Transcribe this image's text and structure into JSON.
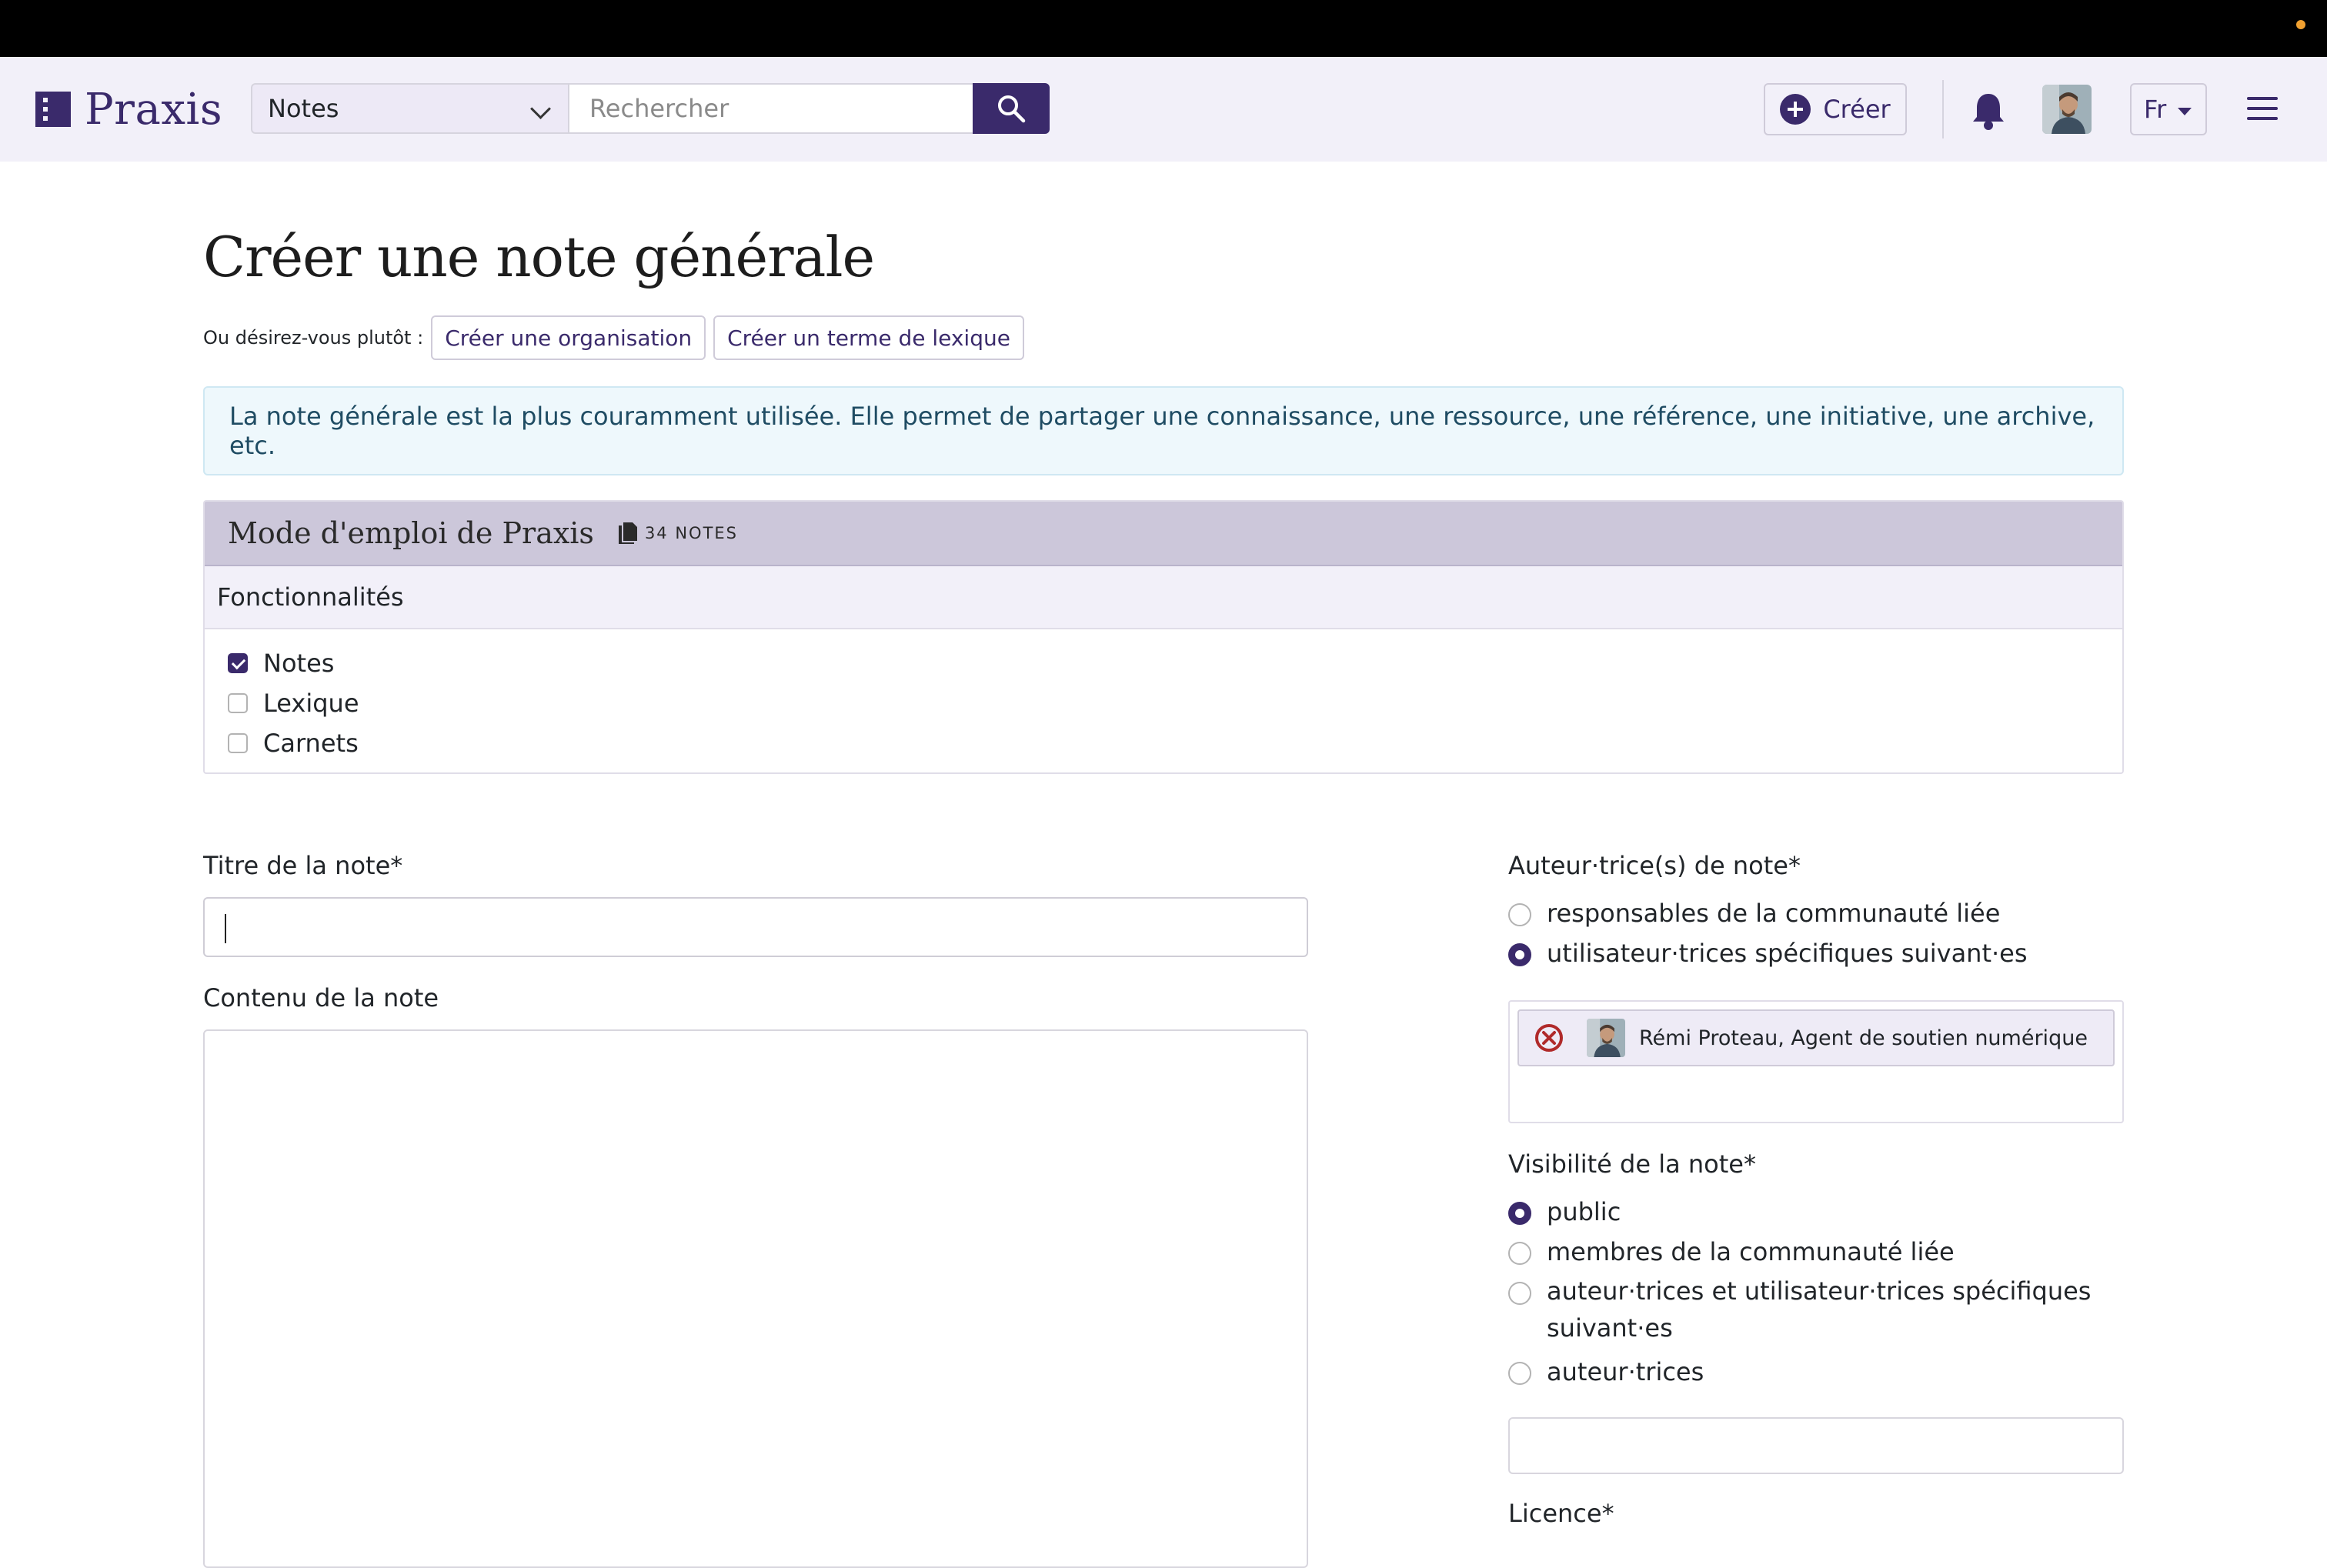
{
  "navbar": {
    "brand": "Praxis",
    "search_scope": "Notes",
    "search_placeholder": "Rechercher",
    "create_label": "Créer",
    "language": "Fr"
  },
  "page": {
    "title": "Créer une note générale",
    "alt_prompt": "Ou désirez-vous plutôt :",
    "alt_buttons": [
      "Créer une organisation",
      "Créer un terme de lexique"
    ],
    "info": "La note générale est la plus couramment utilisée. Elle permet de partager une connaissance, une ressource, une référence, une initiative, une archive, etc."
  },
  "community_card": {
    "title": "Mode d'emploi de Praxis",
    "count": "34 NOTES",
    "section": "Fonctionnalités",
    "features": [
      {
        "label": "Notes",
        "checked": true
      },
      {
        "label": "Lexique",
        "checked": false
      },
      {
        "label": "Carnets",
        "checked": false
      }
    ]
  },
  "form": {
    "title_label": "Titre de la note*",
    "title_value": "",
    "content_label": "Contenu de la note",
    "authors": {
      "label": "Auteur·trice(s) de note*",
      "options": [
        {
          "label": "responsables de la communauté liée",
          "selected": false
        },
        {
          "label": "utilisateur·trices spécifiques suivant·es",
          "selected": true
        }
      ],
      "selected_users": [
        "Rémi Proteau, Agent de soutien numérique"
      ]
    },
    "visibility": {
      "label": "Visibilité de la note*",
      "options": [
        {
          "label": "public",
          "selected": true
        },
        {
          "label": "membres de la communauté liée",
          "selected": false
        },
        {
          "label": "auteur·trices et utilisateur·trices spécifiques",
          "label_line2": "suivant·es",
          "selected": false
        },
        {
          "label": "auteur·trices",
          "selected": false
        }
      ]
    },
    "licence_label": "Licence*"
  },
  "colors": {
    "brand": "#3a2a6b",
    "navbar_bg": "#f2f0f9",
    "info_bg": "#eef8fc",
    "card_head_bg": "#ccc7da",
    "remove": "#b02a2a"
  }
}
